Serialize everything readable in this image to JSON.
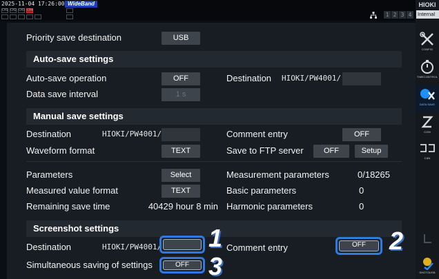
{
  "topbar": {
    "timestamp": "2025-11-04 17:26:00",
    "wideband": "WideBand",
    "channels_row1": [
      "CH1",
      "CH2",
      "CH3",
      "CH4"
    ],
    "sheets": [
      "1",
      "2",
      "3",
      "4"
    ]
  },
  "sidebar": {
    "brand": "HIOKI",
    "mode": "Internal",
    "items": [
      {
        "label": "CONFIG",
        "icon": "wrench-screwdriver-icon"
      },
      {
        "label": "TIMECONTROL",
        "icon": "stopwatch-icon"
      },
      {
        "label": "DATA SAVE",
        "icon": "data-save-icon"
      },
      {
        "label": "COM",
        "icon": "com-icon"
      },
      {
        "label": "CAN",
        "icon": "can-icon"
      },
      {
        "label": "",
        "icon": "hold-icon"
      },
      {
        "label": "SHOTOUSB",
        "icon": "screenshot-icon"
      }
    ]
  },
  "save": {
    "priority_label": "Priority save destination",
    "priority_value": "USB"
  },
  "auto_save": {
    "header": "Auto-save settings",
    "operation_label": "Auto-save operation",
    "operation_value": "OFF",
    "destination_label": "Destination",
    "destination_path": "HIOKI/PW4001/",
    "interval_label": "Data save interval",
    "interval_value": "1 s"
  },
  "manual_save": {
    "header": "Manual save settings",
    "destination_label": "Destination",
    "destination_path": "HIOKI/PW4001/",
    "comment_label": "Comment entry",
    "comment_value": "OFF",
    "waveform_label": "Waveform format",
    "waveform_value": "TEXT",
    "ftp_label": "Save to FTP server",
    "ftp_value": "OFF",
    "ftp_setup": "Setup",
    "parameters_label": "Parameters",
    "parameters_value": "Select",
    "meas_params_label": "Measurement parameters",
    "meas_params_value": "0/18265",
    "measured_format_label": "Measured value format",
    "measured_format_value": "TEXT",
    "basic_params_label": "Basic parameters",
    "basic_params_value": "0",
    "remaining_label": "Remaining save time",
    "remaining_value": "40429 hour 8 min",
    "harmonic_params_label": "Harmonic parameters",
    "harmonic_params_value": "0"
  },
  "screenshot": {
    "header": "Screenshot settings",
    "destination_label": "Destination",
    "destination_path": "HIOKI/PW4001/",
    "comment_label": "Comment entry",
    "comment_value": "OFF",
    "simultaneous_label": "Simultaneous saving of settings",
    "simultaneous_value": "OFF"
  },
  "callouts": [
    "1",
    "2",
    "3"
  ],
  "colors": {
    "background": "#181d23",
    "header": "#232930",
    "button": "#3d444c",
    "callout": "#2e7be0"
  }
}
